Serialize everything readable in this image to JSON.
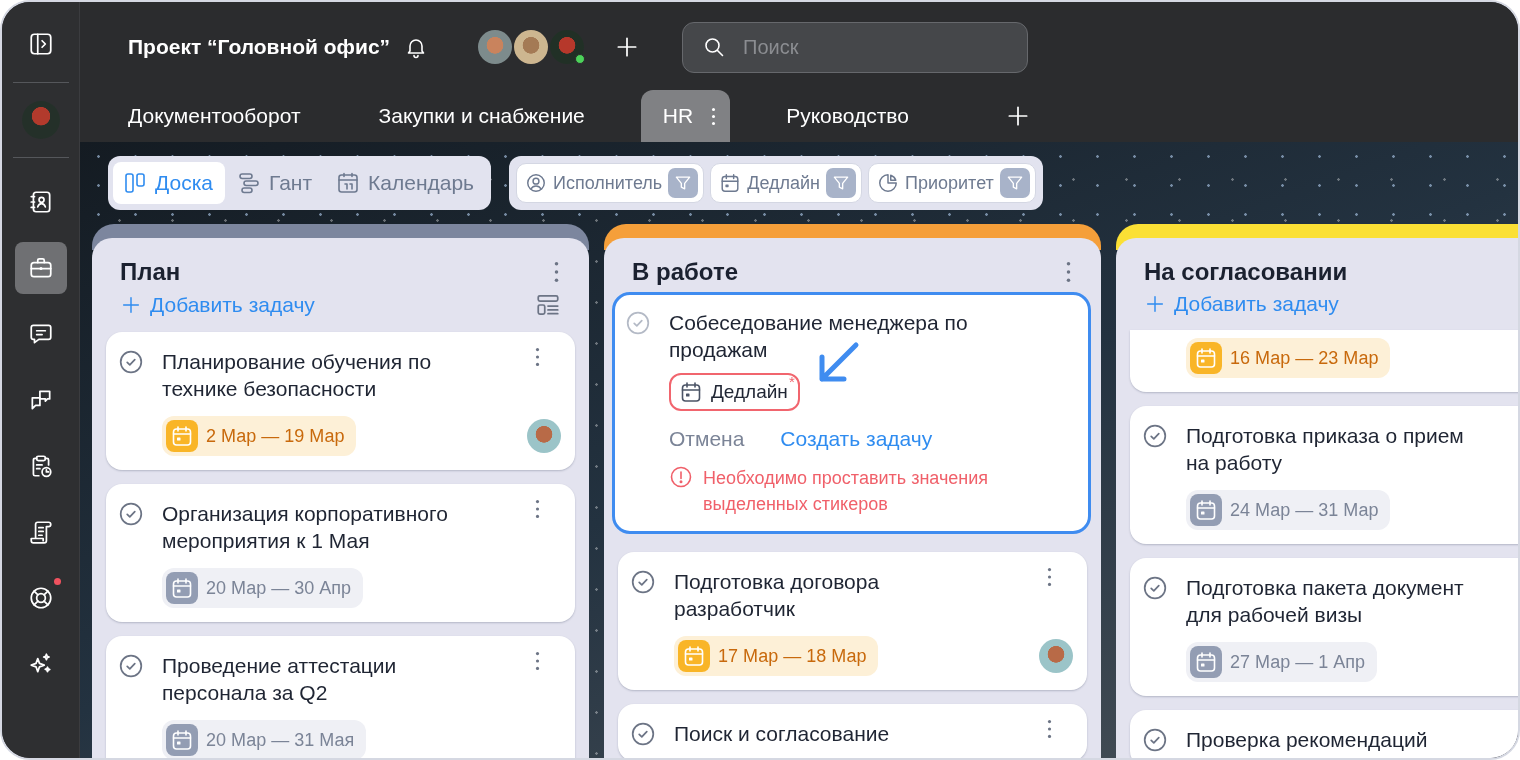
{
  "sidebar": {
    "items": [
      {
        "selected": false,
        "notification": false
      },
      {
        "selected": true,
        "notification": false
      },
      {
        "selected": false,
        "notification": false
      },
      {
        "selected": false,
        "notification": false
      },
      {
        "selected": false,
        "notification": false
      },
      {
        "selected": false,
        "notification": false
      },
      {
        "selected": false,
        "notification": true
      },
      {
        "selected": false,
        "notification": false
      }
    ]
  },
  "header": {
    "title": "Проект “Головной офис”",
    "members": [
      {
        "online": false
      },
      {
        "online": false
      },
      {
        "online": true
      }
    ],
    "search": {
      "placeholder": "Поиск"
    }
  },
  "tabs": [
    {
      "label": "Документооборот",
      "selected": false
    },
    {
      "label": "Закупки и снабжение",
      "selected": false
    },
    {
      "label": "HR",
      "selected": true
    },
    {
      "label": "Руководство",
      "selected": false
    }
  ],
  "views": [
    {
      "label": "Доска",
      "selected": true
    },
    {
      "label": "Гант",
      "selected": false
    },
    {
      "label": "Календарь",
      "selected": false
    }
  ],
  "filters": [
    {
      "label": "Исполнитель"
    },
    {
      "label": "Дедлайн"
    },
    {
      "label": "Приоритет"
    }
  ],
  "columns": [
    {
      "title": "План",
      "color": "#7c869e",
      "menu": true,
      "add_task": "Добавить задачу",
      "layout_toggle": true,
      "cards": [
        {
          "title": "Планирование обучения по\nтехнике безопасности",
          "dates": "2 Мар — 19 Мар",
          "highlighted": true,
          "assignee": true
        },
        {
          "title": "Организация корпоративного\nмероприятия к 1 Мая",
          "dates": "20 Мар — 30 Апр",
          "highlighted": false,
          "assignee": false
        },
        {
          "title": "Проведение аттестации\nперсонала за Q2",
          "dates": "20 Мар — 31 Мая",
          "highlighted": false,
          "assignee": false
        }
      ]
    },
    {
      "title": "В работе",
      "color": "#f59f3a",
      "menu": true,
      "draft": {
        "title": "Собеседование менеджера по\nпродажам",
        "sticker": {
          "label": "Дедлайн",
          "required": true,
          "mark": "*"
        },
        "cancel": "Отмена",
        "create": "Создать задачу",
        "error": "Необходимо проставить значения\nвыделенных стикеров"
      },
      "cards": [
        {
          "title": "Подготовка договора\nразработчик",
          "dates": "17 Мар — 18 Мар",
          "highlighted": true,
          "assignee": true
        },
        {
          "title": "Поиск и согласование",
          "assignee": false
        }
      ]
    },
    {
      "title": "На согласовании",
      "color": "#fbe035",
      "menu": false,
      "add_task": "Добавить задачу",
      "layout_toggle": false,
      "cards": [
        {
          "dates": "16 Мар — 23 Мар",
          "highlighted": true,
          "assignee": false
        },
        {
          "title": "Подготовка приказа о прием\nна работу",
          "dates": "24 Мар — 31 Мар",
          "highlighted": false,
          "assignee": false
        },
        {
          "title": "Подготовка пакета документ\nдля рабочей визы",
          "dates": "27 Мар — 1 Апр",
          "highlighted": false,
          "assignee": false
        },
        {
          "title": "Проверка рекомендаций",
          "assignee": false
        }
      ]
    }
  ]
}
